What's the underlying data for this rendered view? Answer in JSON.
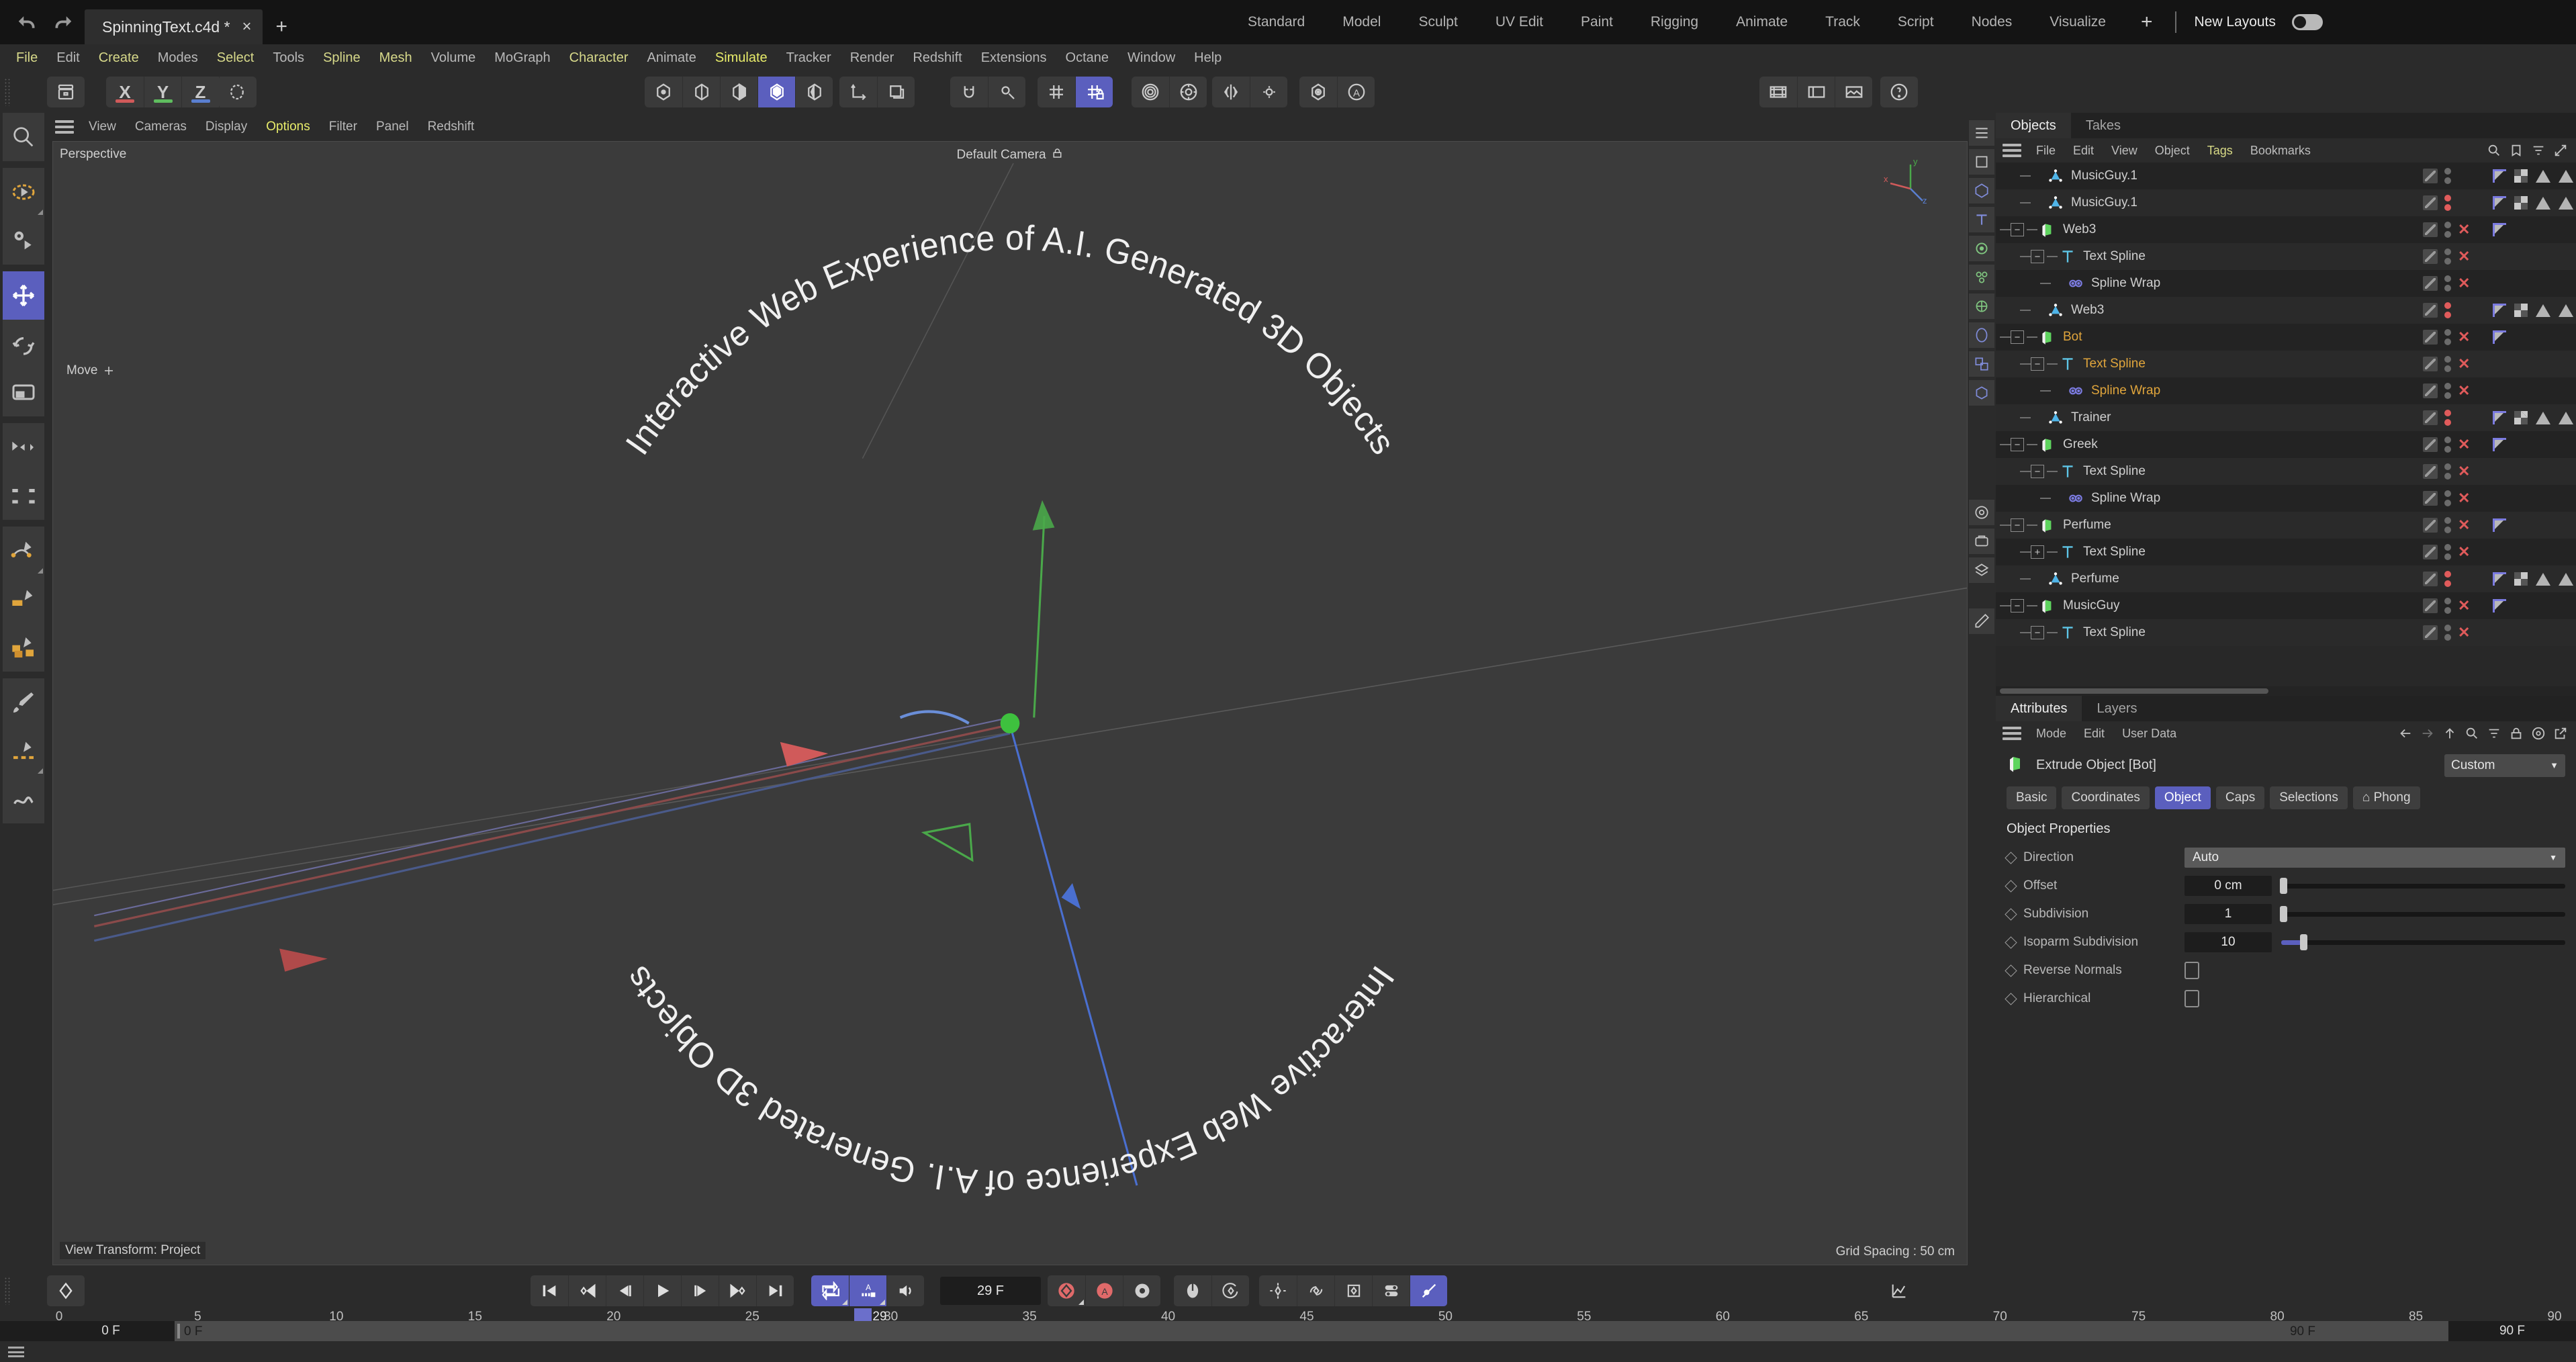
{
  "titlebar": {
    "undo_icon": "undo-icon",
    "redo_icon": "redo-icon",
    "document_tab": "SpinningText.c4d *",
    "close_label": "×",
    "new_tab_label": "+",
    "layout_tabs": [
      "Standard",
      "Model",
      "Sculpt",
      "UV Edit",
      "Paint",
      "Rigging",
      "Animate",
      "Track",
      "Script",
      "Nodes",
      "Visualize"
    ],
    "layout_plus": "+",
    "new_layouts_label": "New Layouts"
  },
  "menubar": {
    "items": [
      {
        "label": "File",
        "style": "y"
      },
      {
        "label": "Edit",
        "style": "n"
      },
      {
        "label": "Create",
        "style": "y"
      },
      {
        "label": "Modes",
        "style": "n"
      },
      {
        "label": "Select",
        "style": "y"
      },
      {
        "label": "Tools",
        "style": "n"
      },
      {
        "label": "Spline",
        "style": "y"
      },
      {
        "label": "Mesh",
        "style": "y"
      },
      {
        "label": "Volume",
        "style": "n"
      },
      {
        "label": "MoGraph",
        "style": "n"
      },
      {
        "label": "Character",
        "style": "y"
      },
      {
        "label": "Animate",
        "style": "n"
      },
      {
        "label": "Simulate",
        "style": "hl"
      },
      {
        "label": "Tracker",
        "style": "n"
      },
      {
        "label": "Render",
        "style": "n"
      },
      {
        "label": "Redshift",
        "style": "n"
      },
      {
        "label": "Extensions",
        "style": "n"
      },
      {
        "label": "Octane",
        "style": "n"
      },
      {
        "label": "Window",
        "style": "n"
      },
      {
        "label": "Help",
        "style": "n"
      }
    ]
  },
  "toolbar": {
    "axis_x": "X",
    "axis_y": "Y",
    "axis_z": "Z",
    "axis_x_color": "#d05a5a",
    "axis_y_color": "#5fbd5f",
    "axis_z_color": "#5a7fd0"
  },
  "viewport": {
    "menu": [
      "View",
      "Cameras",
      "Display",
      "Options",
      "Filter",
      "Panel",
      "Redshift"
    ],
    "menu_highlight": "Options",
    "label_top_left": "Perspective",
    "label_camera": "Default Camera",
    "label_bottom_left": "View Transform: Project",
    "label_bottom_right": "Grid Spacing : 50 cm",
    "tool_hint": "Move",
    "ring_text_outer": "Interactive Web Experience of A.I. Generated 3D Objects",
    "ring_text_inner": "Interactive Web Experience of A.I. Generated 3D Objects",
    "gizmo_axes": [
      "x",
      "y",
      "z"
    ]
  },
  "objects_panel": {
    "tabs": [
      "Objects",
      "Takes"
    ],
    "active_tab": "Objects",
    "menu": [
      "File",
      "Edit",
      "View",
      "Object",
      "Tags",
      "Bookmarks"
    ],
    "menu_highlight": "Tags",
    "rows": [
      {
        "name": "MusicGuy.1",
        "icon": "null-object-icon",
        "depth": 1,
        "expander": "",
        "selected": false,
        "dots": "gray",
        "x": false,
        "tags": [
          "flag",
          "check",
          "tri",
          "tri",
          "tri",
          "tri",
          "tri",
          "tri-o",
          "tri-o",
          "tri-o",
          "tri-o",
          "tri-o"
        ]
      },
      {
        "name": "MusicGuy.1",
        "icon": "null-object-icon",
        "depth": 1,
        "expander": "",
        "selected": false,
        "dots": "red",
        "x": false,
        "tags": [
          "flag",
          "check",
          "tri",
          "tri",
          "tri",
          "tri",
          "tri",
          "tri-o",
          "tri-o",
          "tri-o",
          "tri-o",
          "tri-o"
        ]
      },
      {
        "name": "Web3",
        "icon": "extrude-icon",
        "depth": 0,
        "expander": "−",
        "selected": false,
        "dots": "gray",
        "x": true,
        "tags": [
          "flag"
        ]
      },
      {
        "name": "Text Spline",
        "icon": "text-icon",
        "depth": 1,
        "expander": "−",
        "selected": false,
        "dots": "gray",
        "x": true,
        "tags": []
      },
      {
        "name": "Spline Wrap",
        "icon": "spline-wrap-icon",
        "depth": 2,
        "expander": "",
        "selected": false,
        "dots": "gray",
        "x": true,
        "tags": []
      },
      {
        "name": "Web3",
        "icon": "null-object-icon",
        "depth": 1,
        "expander": "",
        "selected": false,
        "dots": "red",
        "x": false,
        "tags": [
          "flag",
          "check",
          "tri",
          "tri",
          "tri",
          "tri",
          "tri",
          "tri-o",
          "tri-o",
          "tri-o",
          "tri-o",
          "tri-o"
        ]
      },
      {
        "name": "Bot",
        "icon": "extrude-icon",
        "depth": 0,
        "expander": "−",
        "selected": true,
        "dots": "gray",
        "x": true,
        "tags": [
          "flag"
        ]
      },
      {
        "name": "Text Spline",
        "icon": "text-icon",
        "depth": 1,
        "expander": "−",
        "selected": true,
        "dots": "gray",
        "x": true,
        "tags": []
      },
      {
        "name": "Spline Wrap",
        "icon": "spline-wrap-icon",
        "depth": 2,
        "expander": "",
        "selected": true,
        "dots": "gray",
        "x": true,
        "tags": []
      },
      {
        "name": "Trainer",
        "icon": "null-object-icon",
        "depth": 1,
        "expander": "",
        "selected": false,
        "dots": "red",
        "x": false,
        "tags": [
          "flag",
          "check",
          "tri",
          "tri",
          "tri",
          "tri",
          "tri",
          "tri-o",
          "tri-o",
          "tri-o",
          "tri-o",
          "tri-o"
        ]
      },
      {
        "name": "Greek",
        "icon": "extrude-icon",
        "depth": 0,
        "expander": "−",
        "selected": false,
        "dots": "gray",
        "x": true,
        "tags": [
          "flag"
        ]
      },
      {
        "name": "Text Spline",
        "icon": "text-icon",
        "depth": 1,
        "expander": "−",
        "selected": false,
        "dots": "gray",
        "x": true,
        "tags": []
      },
      {
        "name": "Spline Wrap",
        "icon": "spline-wrap-icon",
        "depth": 2,
        "expander": "",
        "selected": false,
        "dots": "gray",
        "x": true,
        "tags": []
      },
      {
        "name": "Perfume",
        "icon": "extrude-icon",
        "depth": 0,
        "expander": "−",
        "selected": false,
        "dots": "gray",
        "x": true,
        "tags": [
          "flag"
        ]
      },
      {
        "name": "Text Spline",
        "icon": "text-icon",
        "depth": 1,
        "expander": "+",
        "selected": false,
        "dots": "gray",
        "x": true,
        "tags": []
      },
      {
        "name": "Perfume",
        "icon": "null-object-icon",
        "depth": 1,
        "expander": "",
        "selected": false,
        "dots": "red",
        "x": false,
        "tags": [
          "flag",
          "check",
          "tri",
          "tri",
          "tri",
          "tri",
          "tri",
          "tri-o",
          "tri-o",
          "tri-o",
          "tri-o",
          "tri-o"
        ]
      },
      {
        "name": "MusicGuy",
        "icon": "extrude-icon",
        "depth": 0,
        "expander": "−",
        "selected": false,
        "dots": "gray",
        "x": true,
        "tags": [
          "flag"
        ]
      },
      {
        "name": "Text Spline",
        "icon": "text-icon",
        "depth": 1,
        "expander": "−",
        "selected": false,
        "dots": "gray",
        "x": true,
        "tags": []
      }
    ]
  },
  "attributes_panel": {
    "tabs": [
      "Attributes",
      "Layers"
    ],
    "active_tab": "Attributes",
    "menu": [
      "Mode",
      "Edit",
      "User Data"
    ],
    "object_label": "Extrude Object [Bot]",
    "preset_dropdown": "Custom",
    "attr_tabs": [
      "Basic",
      "Coordinates",
      "Object",
      "Caps",
      "Selections",
      "⌂ Phong"
    ],
    "active_attr_tab": "Object",
    "section_title": "Object Properties",
    "properties": [
      {
        "label": "Direction",
        "type": "dropdown",
        "value": "Auto"
      },
      {
        "label": "Offset",
        "type": "slider",
        "value": "0 cm",
        "fill_pct": 0,
        "knob_pct": 0
      },
      {
        "label": "Subdivision",
        "type": "slider",
        "value": "1",
        "fill_pct": 0,
        "knob_pct": 0
      },
      {
        "label": "Isoparm Subdivision",
        "type": "slider",
        "value": "10",
        "fill_pct": 7,
        "knob_pct": 7
      },
      {
        "label": "Reverse Normals",
        "type": "checkbox",
        "value": ""
      },
      {
        "label": "Hierarchical",
        "type": "checkbox",
        "value": ""
      }
    ]
  },
  "timeline": {
    "keyframe_button": "keyframe-icon",
    "transport": [
      "go-to-start",
      "prev-key",
      "prev-frame",
      "play",
      "next-frame",
      "next-key",
      "go-to-end"
    ],
    "loop_active": true,
    "autokey_active": true,
    "sound_icon": "speaker-icon",
    "current_frame": "29 F",
    "playhead_label": "29",
    "start_field": "0 F",
    "start_field2": "0 F",
    "end_field": "90 F",
    "end_field2": "90 F",
    "ruler_ticks": [
      0,
      5,
      10,
      15,
      20,
      25,
      30,
      35,
      40,
      45,
      50,
      55,
      60,
      65,
      70,
      75,
      80,
      85,
      90
    ],
    "ruler_min": 0,
    "ruler_max": 90,
    "playhead_frame": 29
  },
  "statusbar": {
    "text": ""
  },
  "colors": {
    "accent_blue": "#5b5fbe",
    "selected_orange": "#e0a53c",
    "menu_yellow": "#d7d98a",
    "highlight_yellow": "#e8ec6a",
    "red_dot": "#e05b5b",
    "panel_bg": "#2b2b2b",
    "viewport_bg": "#3b3b3b"
  }
}
